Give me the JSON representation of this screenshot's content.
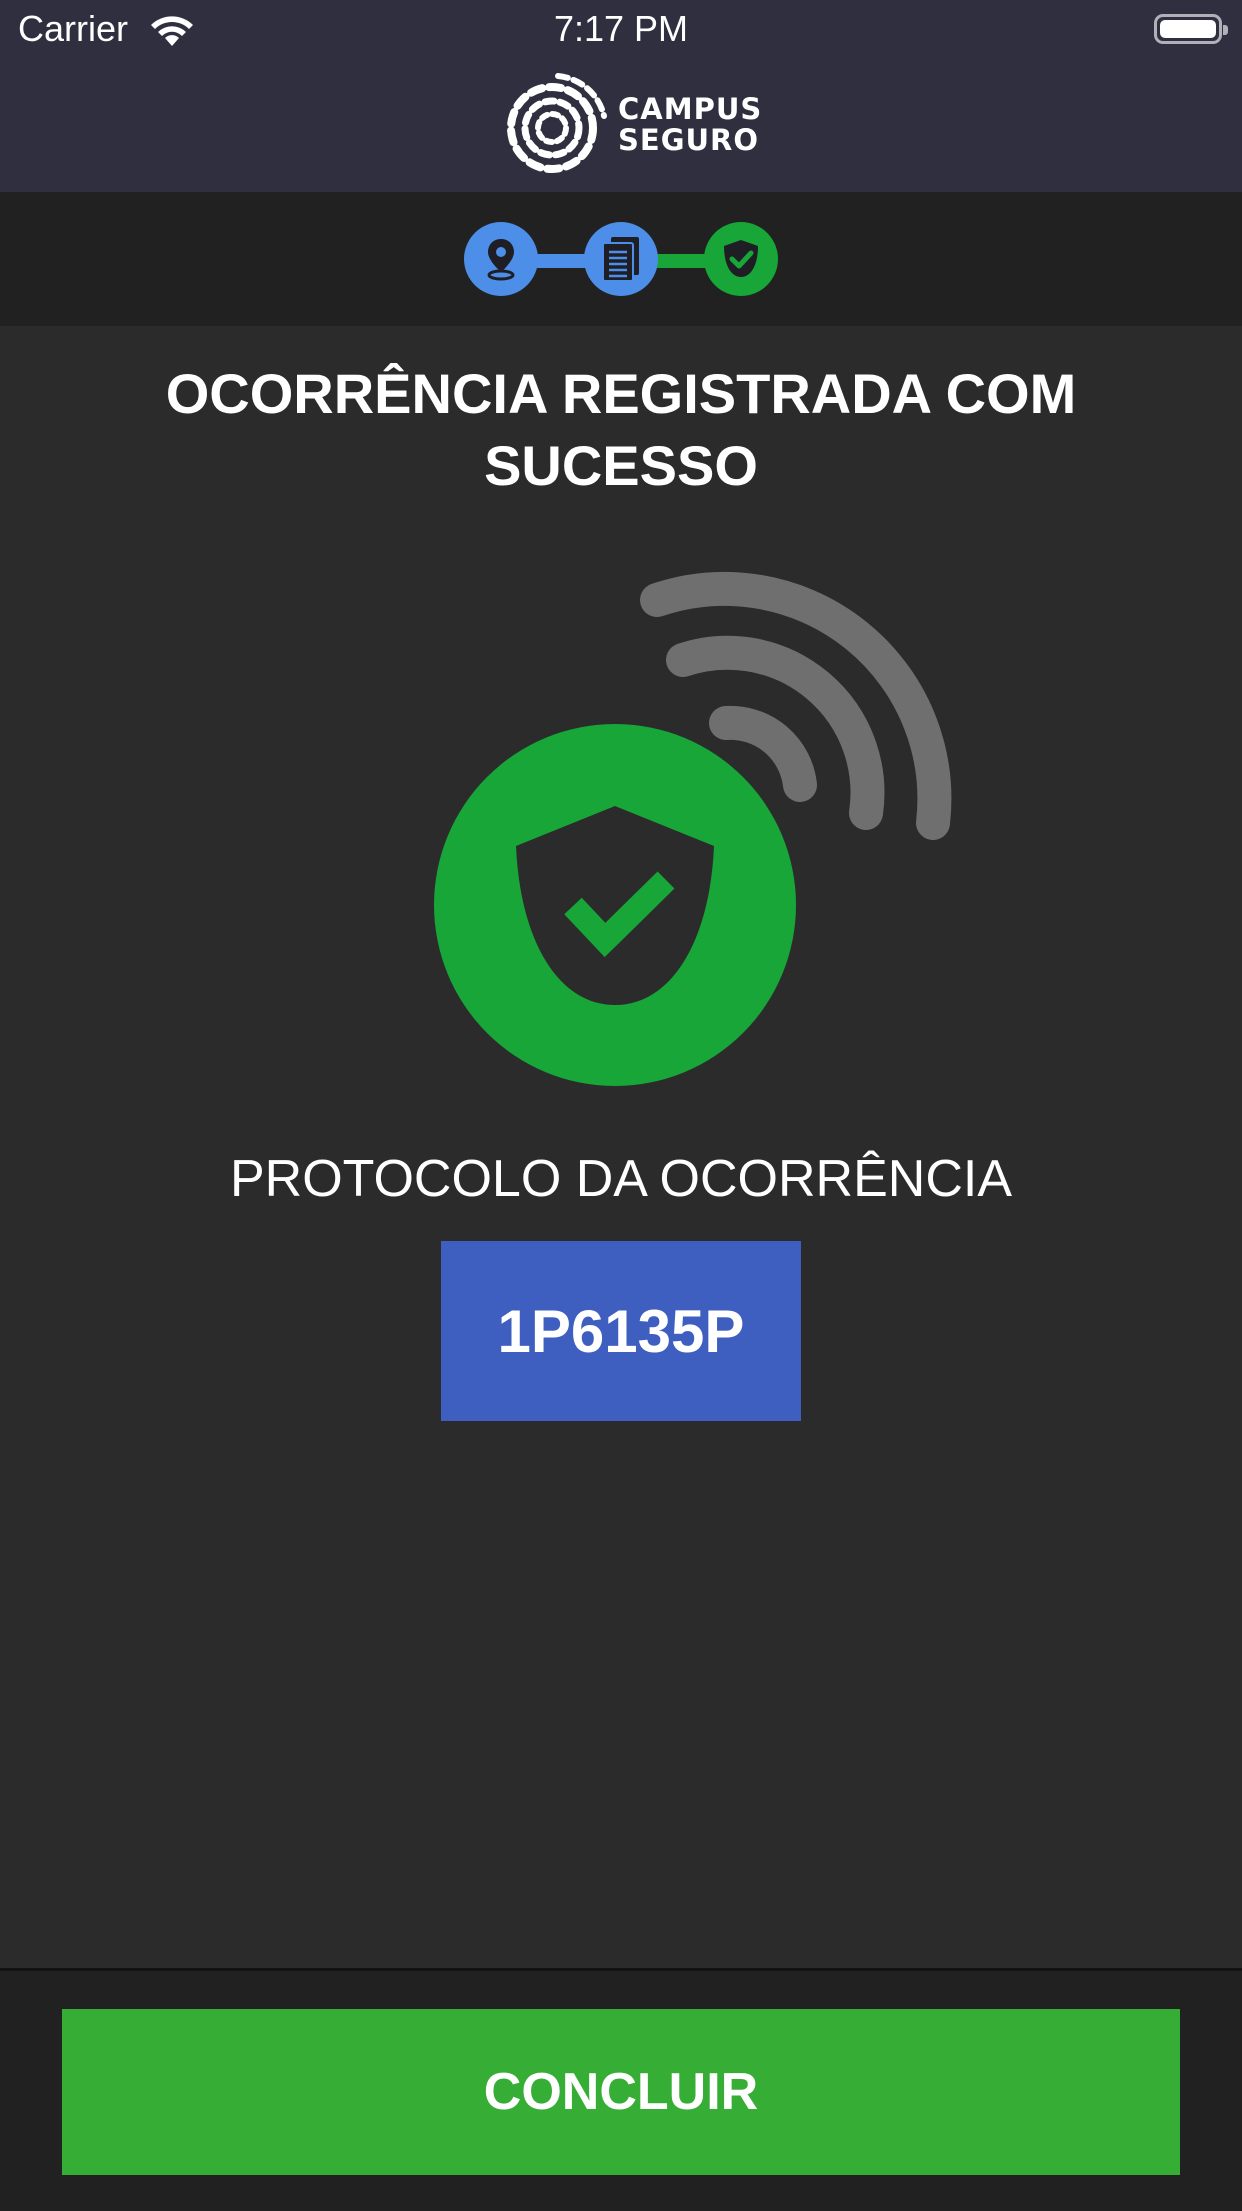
{
  "status_bar": {
    "carrier": "Carrier",
    "time": "7:17 PM",
    "wifi_icon": "wifi-icon",
    "battery_icon": "battery-icon"
  },
  "header": {
    "logo_line1": "CAMPUS",
    "logo_line2": "SEGURO",
    "logo_icon": "campus-seguro-globe-logo"
  },
  "progress": {
    "steps": [
      {
        "icon": "location-pin-icon",
        "color": "#4d8ee8",
        "state": "completed"
      },
      {
        "icon": "document-icon",
        "color": "#4d8ee8",
        "state": "completed"
      },
      {
        "icon": "shield-check-icon",
        "color": "#17a637",
        "state": "current"
      }
    ],
    "line_colors": [
      "#4d8ee8",
      "#17a637"
    ]
  },
  "main": {
    "title": "OCORRÊNCIA REGISTRADA COM SUCESSO",
    "hero_icon": "shield-check-signal-icon",
    "protocol_label": "PROTOCOLO DA OCORRÊNCIA",
    "protocol_code": "1P6135P"
  },
  "footer": {
    "conclude_label": "CONCLUIR"
  },
  "colors": {
    "background": "#2b2b2b",
    "header": "#302f3f",
    "strip": "#212121",
    "success_green": "#17a637",
    "button_green": "#36ad35",
    "protocol_blue": "#3f5fc0",
    "step_blue": "#4d8ee8"
  }
}
